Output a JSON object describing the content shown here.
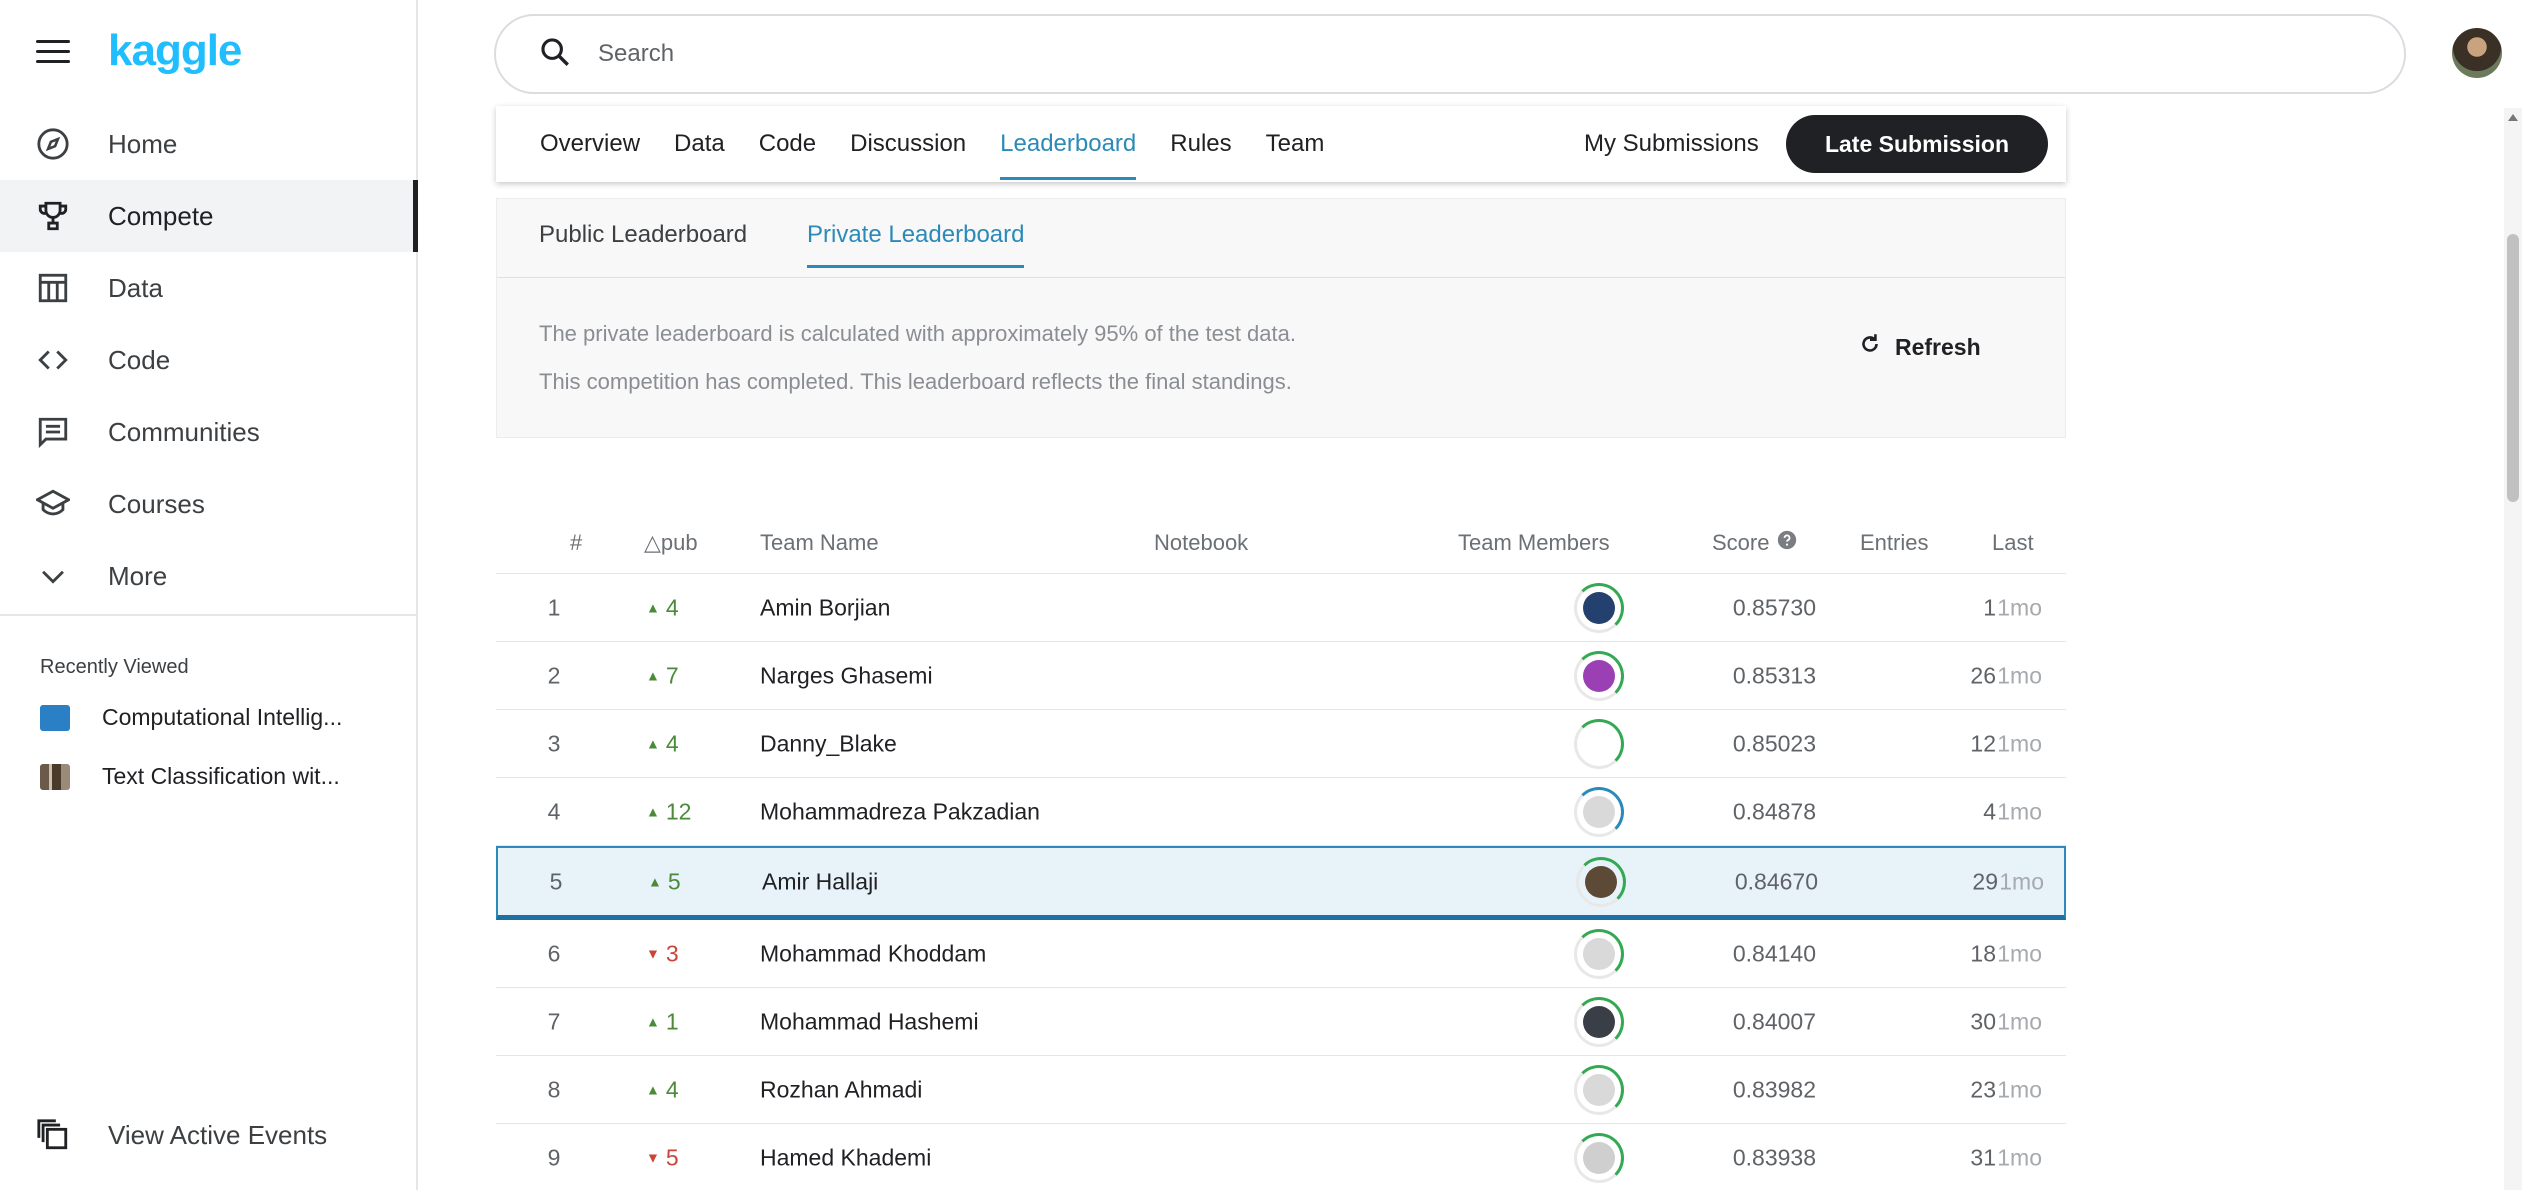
{
  "app": {
    "logo": "kaggle"
  },
  "sidebar": {
    "items": [
      {
        "label": "Home",
        "icon": "compass-icon"
      },
      {
        "label": "Compete",
        "icon": "trophy-icon",
        "active": true
      },
      {
        "label": "Data",
        "icon": "table-icon"
      },
      {
        "label": "Code",
        "icon": "code-icon"
      },
      {
        "label": "Communities",
        "icon": "discussion-icon"
      },
      {
        "label": "Courses",
        "icon": "graduation-cap-icon"
      },
      {
        "label": "More",
        "icon": "chevron-down-icon"
      }
    ],
    "recent_title": "Recently Viewed",
    "recent": [
      {
        "label": "Computational Intellig...",
        "thumb_color": "#2b7fc4"
      },
      {
        "label": "Text Classification wit...",
        "thumb_color": "#5a4a3a"
      }
    ],
    "events_label": "View Active Events"
  },
  "search": {
    "placeholder": "Search"
  },
  "tabs": {
    "items": [
      "Overview",
      "Data",
      "Code",
      "Discussion",
      "Leaderboard",
      "Rules",
      "Team"
    ],
    "active_index": 4,
    "my_submissions": "My Submissions",
    "late_submission": "Late Submission"
  },
  "leaderboard": {
    "subtabs": [
      "Public Leaderboard",
      "Private Leaderboard"
    ],
    "active_subtab": 1,
    "info_line1": "The private leaderboard is calculated with approximately 95% of the test data.",
    "info_line2": "This competition has completed. This leaderboard reflects the final standings.",
    "refresh": "Refresh",
    "accent": "#2b8ab8"
  },
  "table": {
    "headers": {
      "rank": "#",
      "delta": "△pub",
      "team": "Team Name",
      "notebook": "Notebook",
      "members": "Team Members",
      "score": "Score",
      "entries": "Entries",
      "last": "Last"
    },
    "rows": [
      {
        "rank": "1",
        "delta": "4",
        "dir": "up",
        "team": "Amin Borjian",
        "score": "0.85730",
        "entries": "1",
        "last": "1mo",
        "avatar": "#24406e"
      },
      {
        "rank": "2",
        "delta": "7",
        "dir": "up",
        "team": "Narges Ghasemi",
        "score": "0.85313",
        "entries": "26",
        "last": "1mo",
        "avatar": "#9b3fb5"
      },
      {
        "rank": "3",
        "delta": "4",
        "dir": "up",
        "team": "Danny_Blake",
        "score": "0.85023",
        "entries": "12",
        "last": "1mo",
        "avatar": "#ffffff"
      },
      {
        "rank": "4",
        "delta": "12",
        "dir": "up",
        "team": "Mohammadreza Pakzadian",
        "score": "0.84878",
        "entries": "4",
        "last": "1mo",
        "avatar": "#d9d9d9"
      },
      {
        "rank": "5",
        "delta": "5",
        "dir": "up",
        "team": "Amir Hallaji",
        "score": "0.84670",
        "entries": "29",
        "last": "1mo",
        "avatar": "#5c4a36",
        "highlight": true
      },
      {
        "rank": "6",
        "delta": "3",
        "dir": "down",
        "team": "Mohammad Khoddam",
        "score": "0.84140",
        "entries": "18",
        "last": "1mo",
        "avatar": "#d9d9d9"
      },
      {
        "rank": "7",
        "delta": "1",
        "dir": "up",
        "team": "Mohammad Hashemi",
        "score": "0.84007",
        "entries": "30",
        "last": "1mo",
        "avatar": "#3a3f47"
      },
      {
        "rank": "8",
        "delta": "4",
        "dir": "up",
        "team": "Rozhan Ahmadi",
        "score": "0.83982",
        "entries": "23",
        "last": "1mo",
        "avatar": "#d9d9d9"
      },
      {
        "rank": "9",
        "delta": "5",
        "dir": "down",
        "team": "Hamed Khademi",
        "score": "0.83938",
        "entries": "31",
        "last": "1mo",
        "avatar": "#cfcfcf"
      }
    ]
  }
}
